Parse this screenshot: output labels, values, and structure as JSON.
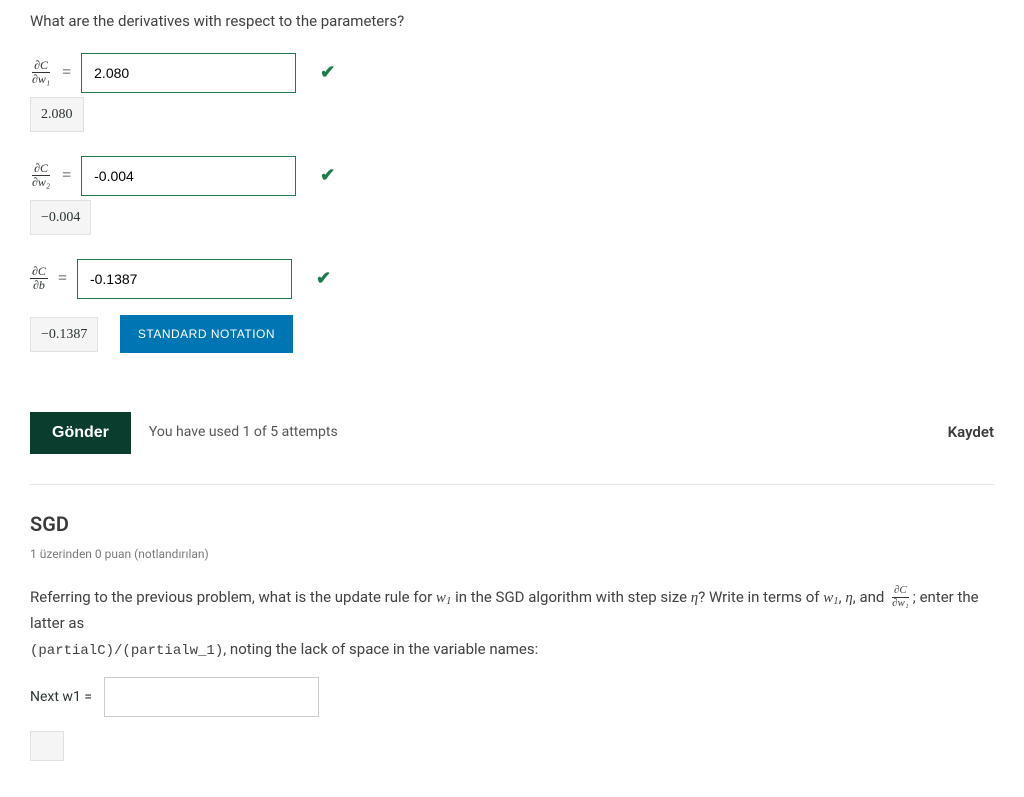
{
  "q1": {
    "prompt": "What are the derivatives with respect to the parameters?",
    "rows": [
      {
        "partial_num": "∂C",
        "partial_den": "∂w₁",
        "value": "2.080",
        "chip": "2.080",
        "correct": true
      },
      {
        "partial_num": "∂C",
        "partial_den": "∂w₂",
        "value": "-0.004",
        "chip": "−0.004",
        "correct": true
      },
      {
        "partial_num": "∂C",
        "partial_den": "∂b",
        "value": "-0.1387",
        "chip": "−0.1387",
        "correct": true
      }
    ],
    "standard_notation_label": "STANDARD NOTATION"
  },
  "submit": {
    "button_label": "Gönder",
    "attempts_text": "You have used 1 of 5 attempts",
    "save_label": "Kaydet"
  },
  "q2": {
    "title": "SGD",
    "points": "1 üzerinden 0 puan (notlandırılan)",
    "para_a": "Referring to the previous problem, what is the update rule for ",
    "para_b": " in the SGD algorithm with step size ",
    "para_c": "? Write in terms of ",
    "para_d": ", ",
    "para_e": ", and ",
    "para_f": "; enter the latter as ",
    "para_g": ", noting the lack of space in the variable names:",
    "w1": "w",
    "eta": "η",
    "frac_num": "∂C",
    "frac_den": "∂w₁",
    "code": "(partialC)/(partialw_1)",
    "next_label_a": "Next ",
    "next_label_b": " ="
  }
}
